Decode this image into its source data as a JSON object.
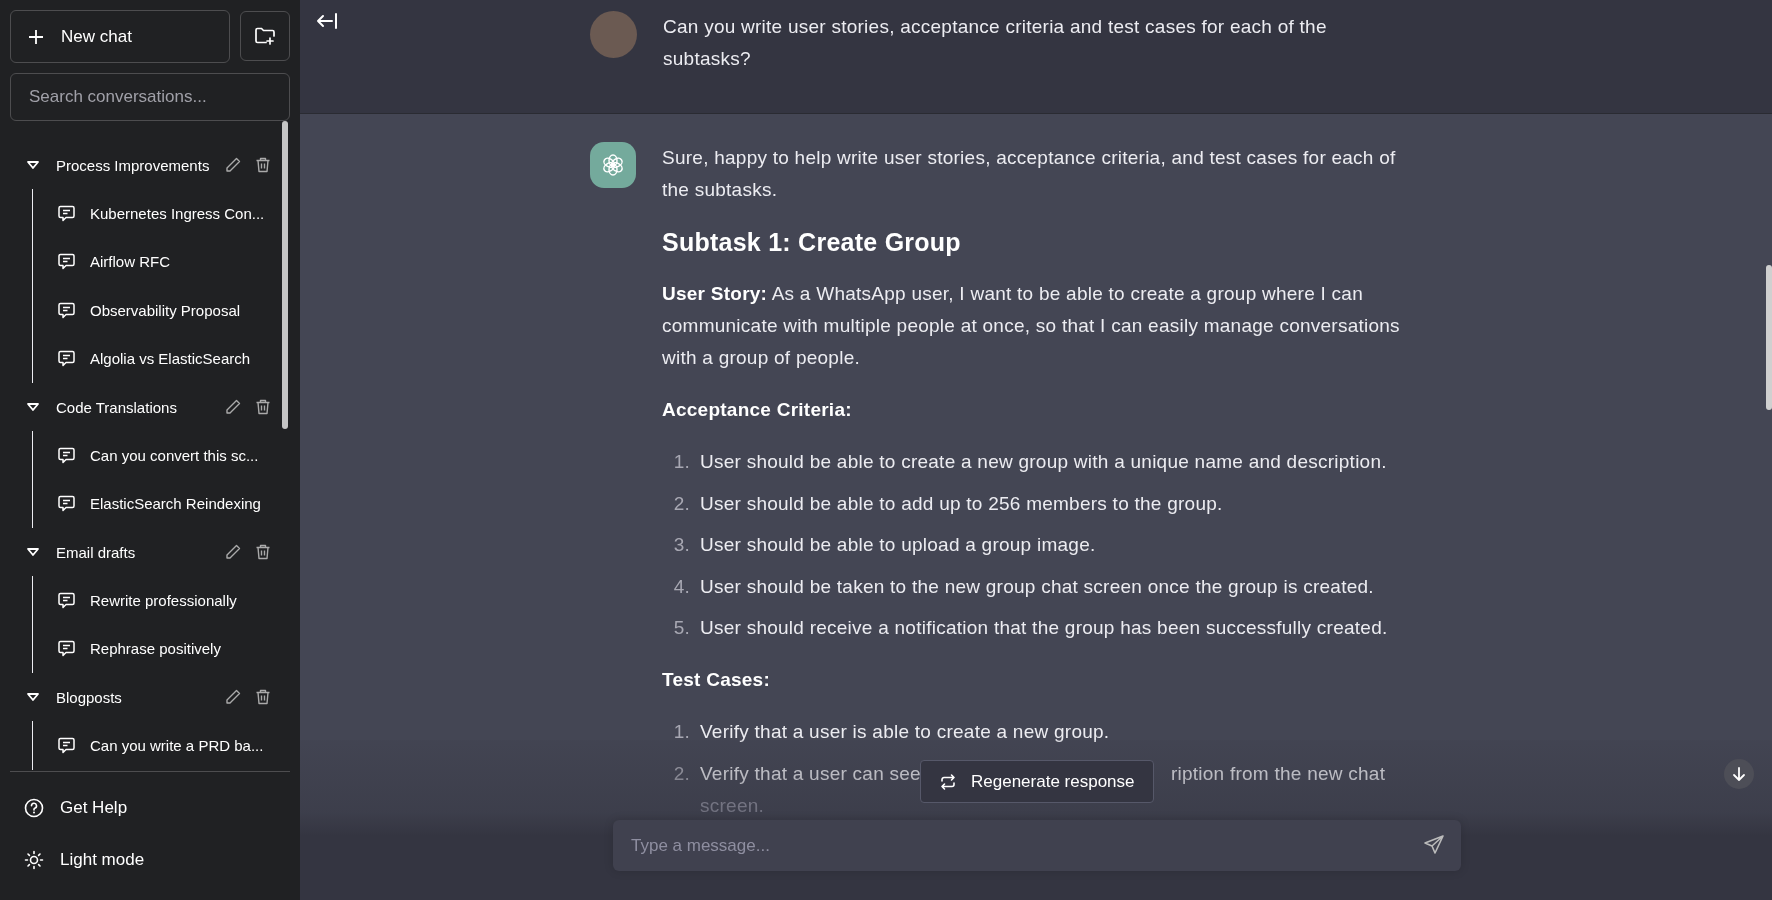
{
  "sidebar": {
    "new_chat": "New chat",
    "search": {
      "placeholder": "Search conversations..."
    },
    "folders": [
      {
        "name": "Process Improvements",
        "expanded": true,
        "chats": [
          "Kubernetes Ingress Con...",
          "Airflow RFC",
          "Observability Proposal",
          "Algolia vs ElasticSearch"
        ]
      },
      {
        "name": "Code Translations",
        "expanded": true,
        "chats": [
          "Can you convert this sc...",
          "ElasticSearch Reindexing"
        ]
      },
      {
        "name": "Email drafts",
        "expanded": true,
        "chats": [
          "Rewrite professionally",
          "Rephrase positively"
        ]
      },
      {
        "name": "Blogposts",
        "expanded": true,
        "chats": [
          "Can you write a PRD ba..."
        ]
      }
    ],
    "footer": [
      {
        "kind": "help",
        "label": "Get Help"
      },
      {
        "kind": "theme",
        "label": "Light mode"
      }
    ]
  },
  "messages": [
    {
      "kind": "user",
      "blocks": [
        {
          "kind": "paragraph",
          "text": "Can you write user stories, acceptance criteria and test cases for each of the subtasks?"
        }
      ]
    },
    {
      "kind": "assistant",
      "blocks": [
        {
          "kind": "paragraph",
          "text": "Sure, happy to help write user stories, acceptance criteria, and test cases for each of the subtasks."
        },
        {
          "kind": "heading",
          "text": "Subtask 1: Create Group"
        },
        {
          "kind": "paragraph",
          "text": "**User Story:** As a WhatsApp user, I want to be able to create a group where I can communicate with multiple people at once, so that I can easily manage conversations with a group of people."
        },
        {
          "kind": "label",
          "text": "Acceptance Criteria:"
        },
        {
          "kind": "list",
          "items": [
            {
              "number": "1.",
              "text": "User should be able to create a new group with a unique name and description."
            },
            {
              "number": "2.",
              "text": "User should be able to add up to 256 members to the group."
            },
            {
              "number": "3.",
              "text": "User should be able to upload a group image."
            },
            {
              "number": "4.",
              "text": "User should be taken to the new group chat screen once the group is created."
            },
            {
              "number": "5.",
              "text": "User should receive a notification that the group has been successfully created."
            }
          ]
        },
        {
          "kind": "label",
          "text": "Test Cases:"
        },
        {
          "kind": "list",
          "items": [
            {
              "number": "1.",
              "text": "Verify that a user is able to create a new group."
            },
            {
              "number": "2.",
              "visible_parts": [
                "Verify that a user can see",
                "ription from the new chat",
                "screen."
              ]
            }
          ]
        }
      ]
    }
  ],
  "regenerate": "Regenerate response",
  "composer": {
    "placeholder": "Type a message..."
  }
}
